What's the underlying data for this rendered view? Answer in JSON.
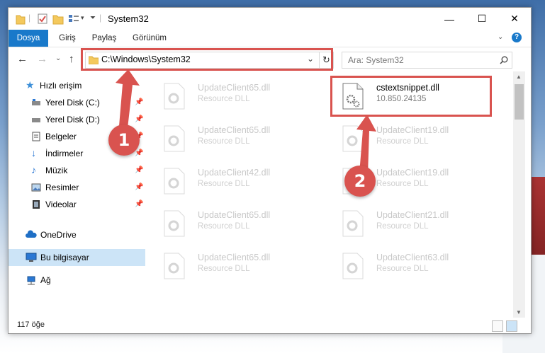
{
  "window": {
    "title": "System32"
  },
  "window_controls": {
    "minimize": "—",
    "maximize": "☐",
    "close": "✕"
  },
  "ribbon": {
    "tabs": [
      "Dosya",
      "Giriş",
      "Paylaş",
      "Görünüm"
    ],
    "help": "?"
  },
  "navbar": {
    "back": "←",
    "forward": "→",
    "recent": "⌄",
    "up": "↑",
    "address": "C:\\Windows\\System32",
    "dropdown": "⌄",
    "refresh": "↻",
    "search_placeholder": "Ara: System32"
  },
  "sidebar": {
    "items": [
      {
        "label": "Hızlı erişim",
        "icon": "star-icon",
        "pinned": false
      },
      {
        "label": "Yerel Disk (C:)",
        "icon": "drive-icon",
        "pinned": true
      },
      {
        "label": "Yerel Disk (D:)",
        "icon": "drive-icon",
        "pinned": true
      },
      {
        "label": "Belgeler",
        "icon": "documents-icon",
        "pinned": true
      },
      {
        "label": "İndirmeler",
        "icon": "download-icon",
        "pinned": true
      },
      {
        "label": "Müzik",
        "icon": "music-icon",
        "pinned": true
      },
      {
        "label": "Resimler",
        "icon": "pictures-icon",
        "pinned": true
      },
      {
        "label": "Videolar",
        "icon": "video-icon",
        "pinned": true
      },
      {
        "label": "OneDrive",
        "icon": "cloud-icon",
        "pinned": false
      },
      {
        "label": "Bu bilgisayar",
        "icon": "computer-icon",
        "pinned": false,
        "selected": true
      },
      {
        "label": "Ağ",
        "icon": "network-icon",
        "pinned": false
      }
    ],
    "pin_glyph": "📌"
  },
  "files": [
    {
      "name": "UpdateClient65.dll",
      "type": "Resource DLL",
      "highlight": false
    },
    {
      "name": "cstextsnippet.dll",
      "type": "10.850.24135",
      "highlight": true
    },
    {
      "name": "UpdateClient65.dll",
      "type": "Resource DLL",
      "highlight": false
    },
    {
      "name": "UpdateClient19.dll",
      "type": "Resource DLL",
      "highlight": false
    },
    {
      "name": "UpdateClient42.dll",
      "type": "Resource DLL",
      "highlight": false
    },
    {
      "name": "UpdateClient19.dll",
      "type": "Resource DLL",
      "highlight": false
    },
    {
      "name": "UpdateClient65.dll",
      "type": "Resource DLL",
      "highlight": false
    },
    {
      "name": "UpdateClient21.dll",
      "type": "Resource DLL",
      "highlight": false
    },
    {
      "name": "UpdateClient65.dll",
      "type": "Resource DLL",
      "highlight": false
    },
    {
      "name": "UpdateClient63.dll",
      "type": "Resource DLL",
      "highlight": false
    }
  ],
  "status": {
    "count": "117 öğe"
  },
  "annotations": {
    "step1": "1",
    "step2": "2",
    "color": "#d9534f"
  }
}
